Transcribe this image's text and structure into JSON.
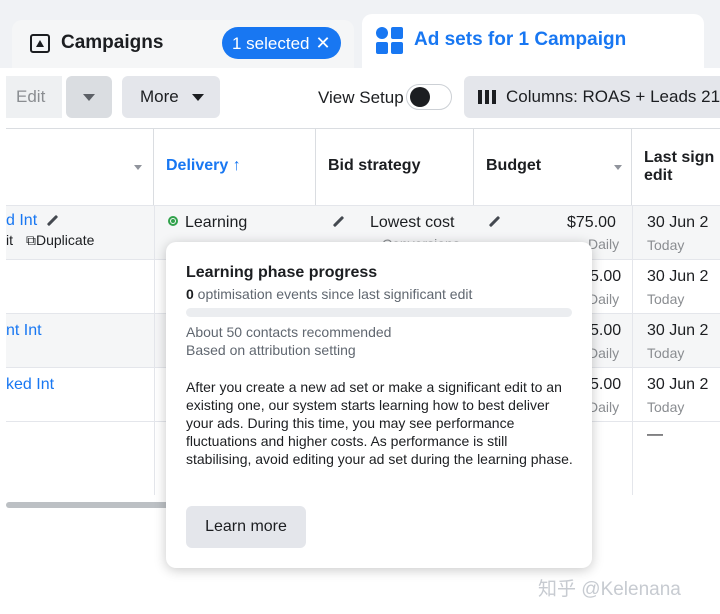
{
  "tabs": {
    "campaigns": {
      "label": "Campaigns",
      "chip": "1 selected"
    },
    "adsets": {
      "label": "Ad sets for 1 Campaign"
    }
  },
  "toolbar": {
    "edit_label": "Edit",
    "more_label": "More",
    "view_setup_label": "View Setup",
    "view_setup_on": false,
    "columns_label": "Columns: ROAS + Leads 21"
  },
  "table": {
    "headers": {
      "delivery": "Delivery ↑",
      "bid_strategy": "Bid strategy",
      "budget": "Budget",
      "last_edit_line1": "Last sign",
      "last_edit_line2": "edit"
    },
    "rows": [
      {
        "name": "d Int",
        "actions_left": "it",
        "actions_duplicate": "Duplicate",
        "delivery": "Learning",
        "bid": "Lowest cost",
        "bid_sub": "Conversions",
        "budget": "$75.00",
        "budget_sub": "Daily",
        "last_edit": "30 Jun 2",
        "last_edit_sub": "Today"
      },
      {
        "name": "",
        "budget": "5.00",
        "budget_sub": "Daily",
        "last_edit": "30 Jun 2",
        "last_edit_sub": "Today"
      },
      {
        "name": "nt Int",
        "budget": "5.00",
        "budget_sub": "Daily",
        "last_edit": "30 Jun 2",
        "last_edit_sub": "Today"
      },
      {
        "name": "ked Int",
        "budget": "5.00",
        "budget_sub": "Daily",
        "last_edit": "30 Jun 2",
        "last_edit_sub": "Today"
      },
      {
        "name": "",
        "last_edit": "—"
      }
    ]
  },
  "popover": {
    "title": "Learning phase progress",
    "count": "0",
    "subtitle_rest": " optimisation events since last significant edit",
    "progress_fraction": 0,
    "note1": "About 50 contacts recommended",
    "note2": "Based on attribution setting",
    "body": "After you create a new ad set or make a significant edit to an existing one, our system starts learning how to best deliver your ads. During this time, you may see performance fluctuations and higher costs. As performance is still stabilising, avoid editing your ad set during the learning phase.",
    "button_label": "Learn more"
  },
  "watermark": "知乎 @Kelenana",
  "colors": {
    "accent": "#1877f2",
    "learning": "#31a24c"
  },
  "icons": [
    "campaign-flag-icon",
    "close-icon",
    "adsets-grid-icon",
    "chevron-down-icon",
    "columns-icon",
    "sort-arrow-icon",
    "pencil-icon",
    "duplicate-icon",
    "status-dot-icon"
  ]
}
